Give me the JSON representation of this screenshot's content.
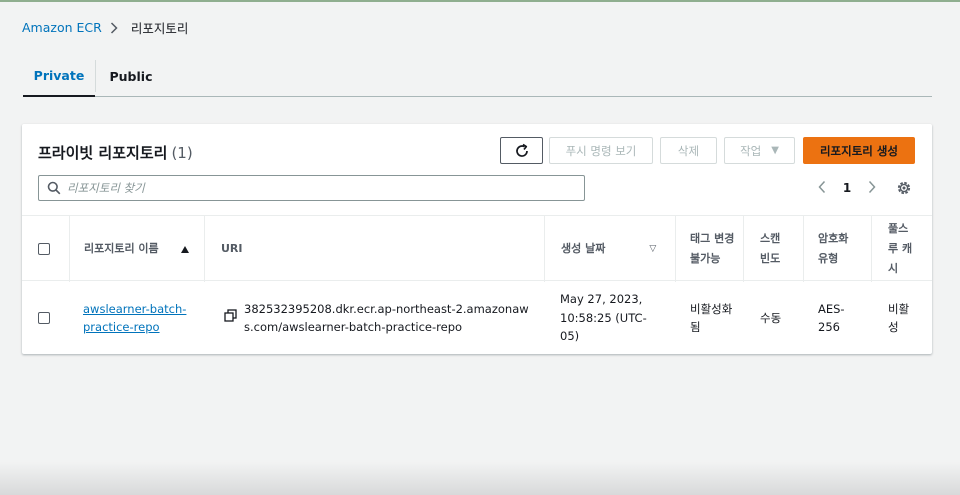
{
  "breadcrumb": {
    "root": "Amazon ECR",
    "current": "리포지토리"
  },
  "tabs": [
    {
      "label": "Private",
      "active": true
    },
    {
      "label": "Public",
      "active": false
    }
  ],
  "panel": {
    "title": "프라이빗 리포지토리",
    "count": "(1)",
    "buttons": {
      "refresh_icon": "refresh-icon",
      "view_push": "푸시 명령 보기",
      "delete": "삭제",
      "actions": "작업",
      "create": "리포지토리 생성"
    },
    "search": {
      "placeholder": "리포지토리 찾기",
      "value": ""
    },
    "pagination": {
      "page": "1"
    }
  },
  "table": {
    "headers": {
      "name": "리포지토리 이름",
      "uri": "URI",
      "created": "생성 날짜",
      "tag_immutability": "태그 변경 불가능",
      "scan": "스캔 빈도",
      "encryption": "암호화 유형",
      "pull_cache": "풀스루 캐시"
    },
    "rows": [
      {
        "name": "awslearner-batch-practice-repo",
        "uri": "382532395208.dkr.ecr.ap-northeast-2.amazonaws.com/awslearner-batch-practice-repo",
        "created": "May 27, 2023, 10:58:25 (UTC-05)",
        "tag_immutability": "비활성화됨",
        "scan": "수동",
        "encryption": "AES-256",
        "pull_cache": "비활성"
      }
    ]
  },
  "colors": {
    "link": "#0073bb",
    "primary_button": "#ec7211",
    "page_bg": "#f2f3f3"
  }
}
